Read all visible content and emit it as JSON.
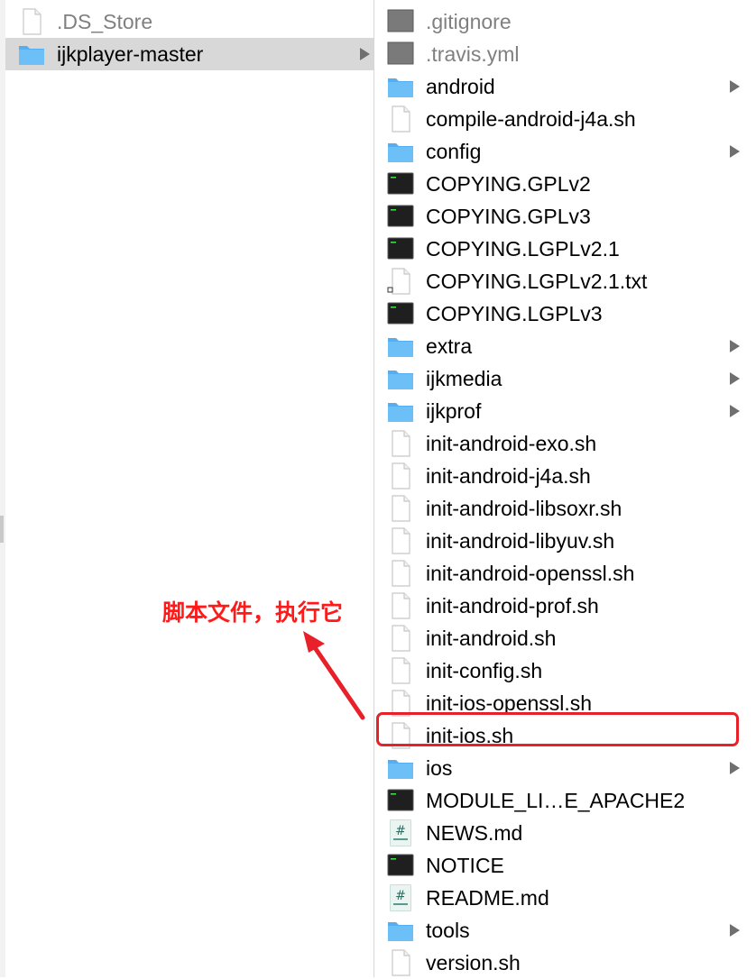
{
  "left_column": {
    "items": [
      {
        "label": ".DS_Store",
        "icon": "generic-file-icon",
        "dim": true,
        "selected": false,
        "folder": false
      },
      {
        "label": "ijkplayer-master",
        "icon": "folder-icon",
        "dim": false,
        "selected": true,
        "folder": true
      }
    ]
  },
  "right_column": {
    "items": [
      {
        "label": ".gitignore",
        "icon": "gray-file-icon",
        "dim": true,
        "folder": false
      },
      {
        "label": ".travis.yml",
        "icon": "gray-file-icon",
        "dim": true,
        "folder": false
      },
      {
        "label": "android",
        "icon": "folder-icon",
        "dim": false,
        "folder": true
      },
      {
        "label": "compile-android-j4a.sh",
        "icon": "generic-file-icon",
        "dim": false,
        "folder": false
      },
      {
        "label": "config",
        "icon": "folder-icon",
        "dim": false,
        "folder": true
      },
      {
        "label": "COPYING.GPLv2",
        "icon": "terminal-icon",
        "dim": false,
        "folder": false
      },
      {
        "label": "COPYING.GPLv3",
        "icon": "terminal-icon",
        "dim": false,
        "folder": false
      },
      {
        "label": "COPYING.LGPLv2.1",
        "icon": "terminal-icon",
        "dim": false,
        "folder": false
      },
      {
        "label": "COPYING.LGPLv2.1.txt",
        "icon": "alias-file-icon",
        "dim": false,
        "folder": false
      },
      {
        "label": "COPYING.LGPLv3",
        "icon": "terminal-icon",
        "dim": false,
        "folder": false
      },
      {
        "label": "extra",
        "icon": "folder-icon",
        "dim": false,
        "folder": true
      },
      {
        "label": "ijkmedia",
        "icon": "folder-icon",
        "dim": false,
        "folder": true
      },
      {
        "label": "ijkprof",
        "icon": "folder-icon",
        "dim": false,
        "folder": true
      },
      {
        "label": "init-android-exo.sh",
        "icon": "generic-file-icon",
        "dim": false,
        "folder": false
      },
      {
        "label": "init-android-j4a.sh",
        "icon": "generic-file-icon",
        "dim": false,
        "folder": false
      },
      {
        "label": "init-android-libsoxr.sh",
        "icon": "generic-file-icon",
        "dim": false,
        "folder": false
      },
      {
        "label": "init-android-libyuv.sh",
        "icon": "generic-file-icon",
        "dim": false,
        "folder": false
      },
      {
        "label": "init-android-openssl.sh",
        "icon": "generic-file-icon",
        "dim": false,
        "folder": false
      },
      {
        "label": "init-android-prof.sh",
        "icon": "generic-file-icon",
        "dim": false,
        "folder": false
      },
      {
        "label": "init-android.sh",
        "icon": "generic-file-icon",
        "dim": false,
        "folder": false
      },
      {
        "label": "init-config.sh",
        "icon": "generic-file-icon",
        "dim": false,
        "folder": false
      },
      {
        "label": "init-ios-openssl.sh",
        "icon": "generic-file-icon",
        "dim": false,
        "folder": false
      },
      {
        "label": "init-ios.sh",
        "icon": "generic-file-icon",
        "dim": false,
        "folder": false
      },
      {
        "label": "ios",
        "icon": "folder-icon",
        "dim": false,
        "folder": true
      },
      {
        "label": "MODULE_LI…E_APACHE2",
        "icon": "terminal-icon",
        "dim": false,
        "folder": false
      },
      {
        "label": "NEWS.md",
        "icon": "markdown-file-icon",
        "dim": false,
        "folder": false
      },
      {
        "label": "NOTICE",
        "icon": "terminal-icon",
        "dim": false,
        "folder": false
      },
      {
        "label": "README.md",
        "icon": "markdown-file-icon",
        "dim": false,
        "folder": false
      },
      {
        "label": "tools",
        "icon": "folder-icon",
        "dim": false,
        "folder": true
      },
      {
        "label": "version.sh",
        "icon": "generic-file-icon",
        "dim": false,
        "folder": false
      }
    ]
  },
  "annotation": {
    "text": "脚本文件，执行它",
    "color": "#ff1a1a",
    "highlighted_item": "init-ios.sh"
  },
  "colors": {
    "folder": "#5ab4f0",
    "selection": "#d8d8d8",
    "highlight_border": "#e8202a"
  }
}
